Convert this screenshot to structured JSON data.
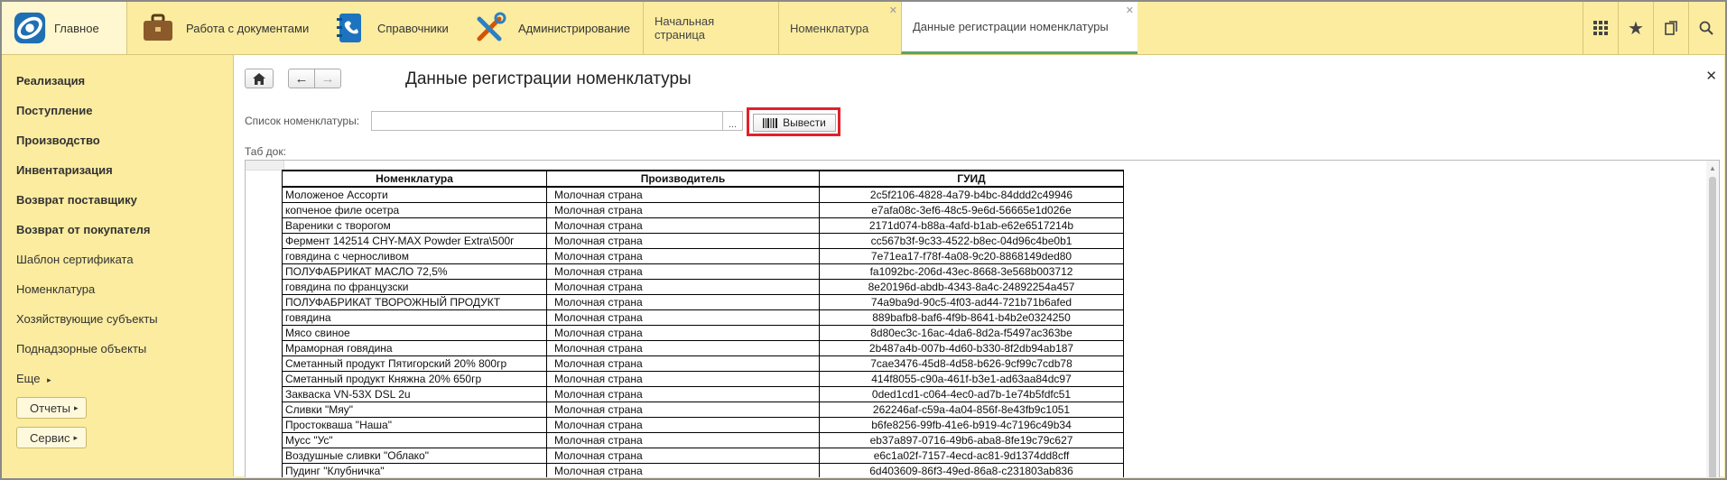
{
  "topbar": {
    "sections": [
      {
        "label": "Главное",
        "icon": "app-logo-icon"
      },
      {
        "label": "Работа с документами",
        "icon": "briefcase-icon"
      },
      {
        "label": "Справочники",
        "icon": "address-book-icon"
      },
      {
        "label": "Администрирование",
        "icon": "tools-icon"
      }
    ],
    "tabs": [
      {
        "label": "Начальная страница",
        "closable": false,
        "active": false
      },
      {
        "label": "Номенклатура",
        "closable": true,
        "active": false
      },
      {
        "label": "Данные регистрации номенклатуры",
        "closable": true,
        "active": true
      }
    ],
    "right_icons": [
      "grid-menu-icon",
      "star-icon",
      "history-icon",
      "search-icon"
    ]
  },
  "nav": {
    "items": [
      {
        "label": "Реализация",
        "bold": true
      },
      {
        "label": "Поступление",
        "bold": true
      },
      {
        "label": "Производство",
        "bold": true
      },
      {
        "label": "Инвентаризация",
        "bold": true
      },
      {
        "label": "Возврат поставщику",
        "bold": true
      },
      {
        "label": "Возврат от покупателя",
        "bold": true
      },
      {
        "label": "Шаблон сертификата",
        "bold": false
      },
      {
        "label": "Номенклатура",
        "bold": false
      },
      {
        "label": "Хозяйствующие субъекты",
        "bold": false
      },
      {
        "label": "Поднадзорные объекты",
        "bold": false
      },
      {
        "label": "Еще",
        "bold": false
      }
    ],
    "buttons": [
      {
        "label": "Отчеты"
      },
      {
        "label": "Сервис"
      }
    ]
  },
  "form": {
    "title": "Данные регистрации номенклатуры",
    "list_label": "Список номенклатуры:",
    "list_value": "",
    "ellipsis": "...",
    "output_button": "Вывести",
    "tabdoc_label": "Таб док:"
  },
  "table": {
    "headers": [
      "Номенклатура",
      "Производитель",
      "ГУИД"
    ],
    "rows": [
      [
        "Моложеное Ассорти",
        "Молочная страна",
        "2c5f2106-4828-4a79-b4bc-84ddd2c49946"
      ],
      [
        "копченое филе осетра",
        "Молочная страна",
        "e7afa08c-3ef6-48c5-9e6d-56665e1d026e"
      ],
      [
        "Вареники с творогом",
        "Молочная страна",
        "2171d074-b88a-4afd-b1ab-e62e6517214b"
      ],
      [
        "Фермент 142514 CHY-MAX Powder Extra\\500г",
        "Молочная страна",
        "cc567b3f-9c33-4522-b8ec-04d96c4be0b1"
      ],
      [
        "говядина с черносливом",
        "Молочная страна",
        "7e71ea17-f78f-4a08-9c20-8868149ded80"
      ],
      [
        "ПОЛУФАБРИКАТ МАСЛО 72,5%",
        "Молочная страна",
        "fa1092bc-206d-43ec-8668-3e568b003712"
      ],
      [
        "говядина по французски",
        "Молочная страна",
        "8e20196d-abdb-4343-8a4c-24892254a457"
      ],
      [
        "ПОЛУФАБРИКАТ ТВОРОЖНЫЙ ПРОДУКТ",
        "Молочная страна",
        "74a9ba9d-90c5-4f03-ad44-721b71b6afed"
      ],
      [
        "говядина",
        "Молочная страна",
        "889bafb8-baf6-4f9b-8641-b4b2e0324250"
      ],
      [
        "Мясо свиное",
        "Молочная страна",
        "8d80ec3c-16ac-4da6-8d2a-f5497ac363be"
      ],
      [
        "Мраморная говядина",
        "Молочная страна",
        "2b487a4b-007b-4d60-b330-8f2db94ab187"
      ],
      [
        "Сметанный продукт Пятигорский 20% 800гр",
        "Молочная страна",
        "7cae3476-45d8-4d58-b626-9cf99c7cdb78"
      ],
      [
        "Сметанный продукт Княжна 20% 650гр",
        "Молочная страна",
        "414f8055-c90a-461f-b3e1-ad63aa84dc97"
      ],
      [
        "Закваска VN-53X DSL 2u",
        "Молочная страна",
        "0ded1cd1-c064-4ec0-ad7b-1e74b5fdfc51"
      ],
      [
        "Сливки \"Мяу\"",
        "Молочная страна",
        "262246af-c59a-4a04-856f-8e43fb9c1051"
      ],
      [
        "Простокваша \"Наша\"",
        "Молочная страна",
        "b6fe8256-99fb-41e6-b919-4c7196c49b34"
      ],
      [
        "Мусс \"Ус\"",
        "Молочная страна",
        "eb37a897-0716-49b6-aba8-8fe19c79c627"
      ],
      [
        "Воздушные сливки \"Облако\"",
        "Молочная страна",
        "e6c1a02f-7157-4ecd-ac81-9d1374dd8cff"
      ],
      [
        "Пудинг \"Клубничка\"",
        "Молочная страна",
        "6d403609-86f3-49ed-86a8-c231803ab836"
      ]
    ]
  }
}
